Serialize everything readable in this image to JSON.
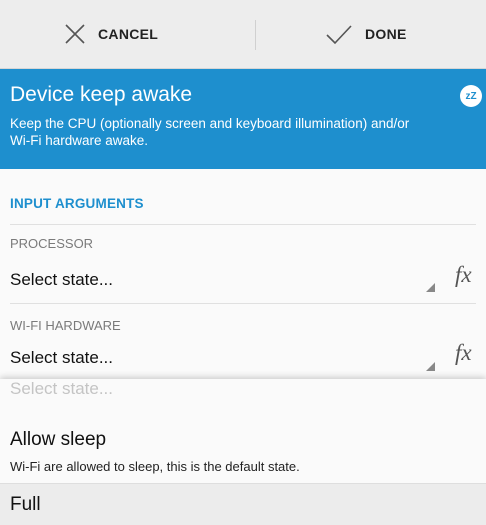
{
  "toolbar": {
    "cancel_label": "CANCEL",
    "done_label": "DONE"
  },
  "header": {
    "title": "Device keep awake",
    "description": "Keep the CPU (optionally screen and keyboard illumination) and/or Wi-Fi hardware awake.",
    "icon": "sleep-zzz-icon",
    "accent": "#1e8fce"
  },
  "inputs": {
    "section_title": "INPUT ARGUMENTS",
    "processor": {
      "label": "PROCESSOR",
      "value": "Select state...",
      "fx": "fx"
    },
    "wifi": {
      "label": "WI-FI HARDWARE",
      "value": "Select state...",
      "fx": "fx"
    }
  },
  "dropdown": {
    "placeholder": "Select state...",
    "options": [
      {
        "label": "Allow sleep",
        "description": "Wi-Fi are allowed to sleep, this is the default state."
      },
      {
        "label": "Full"
      }
    ]
  }
}
